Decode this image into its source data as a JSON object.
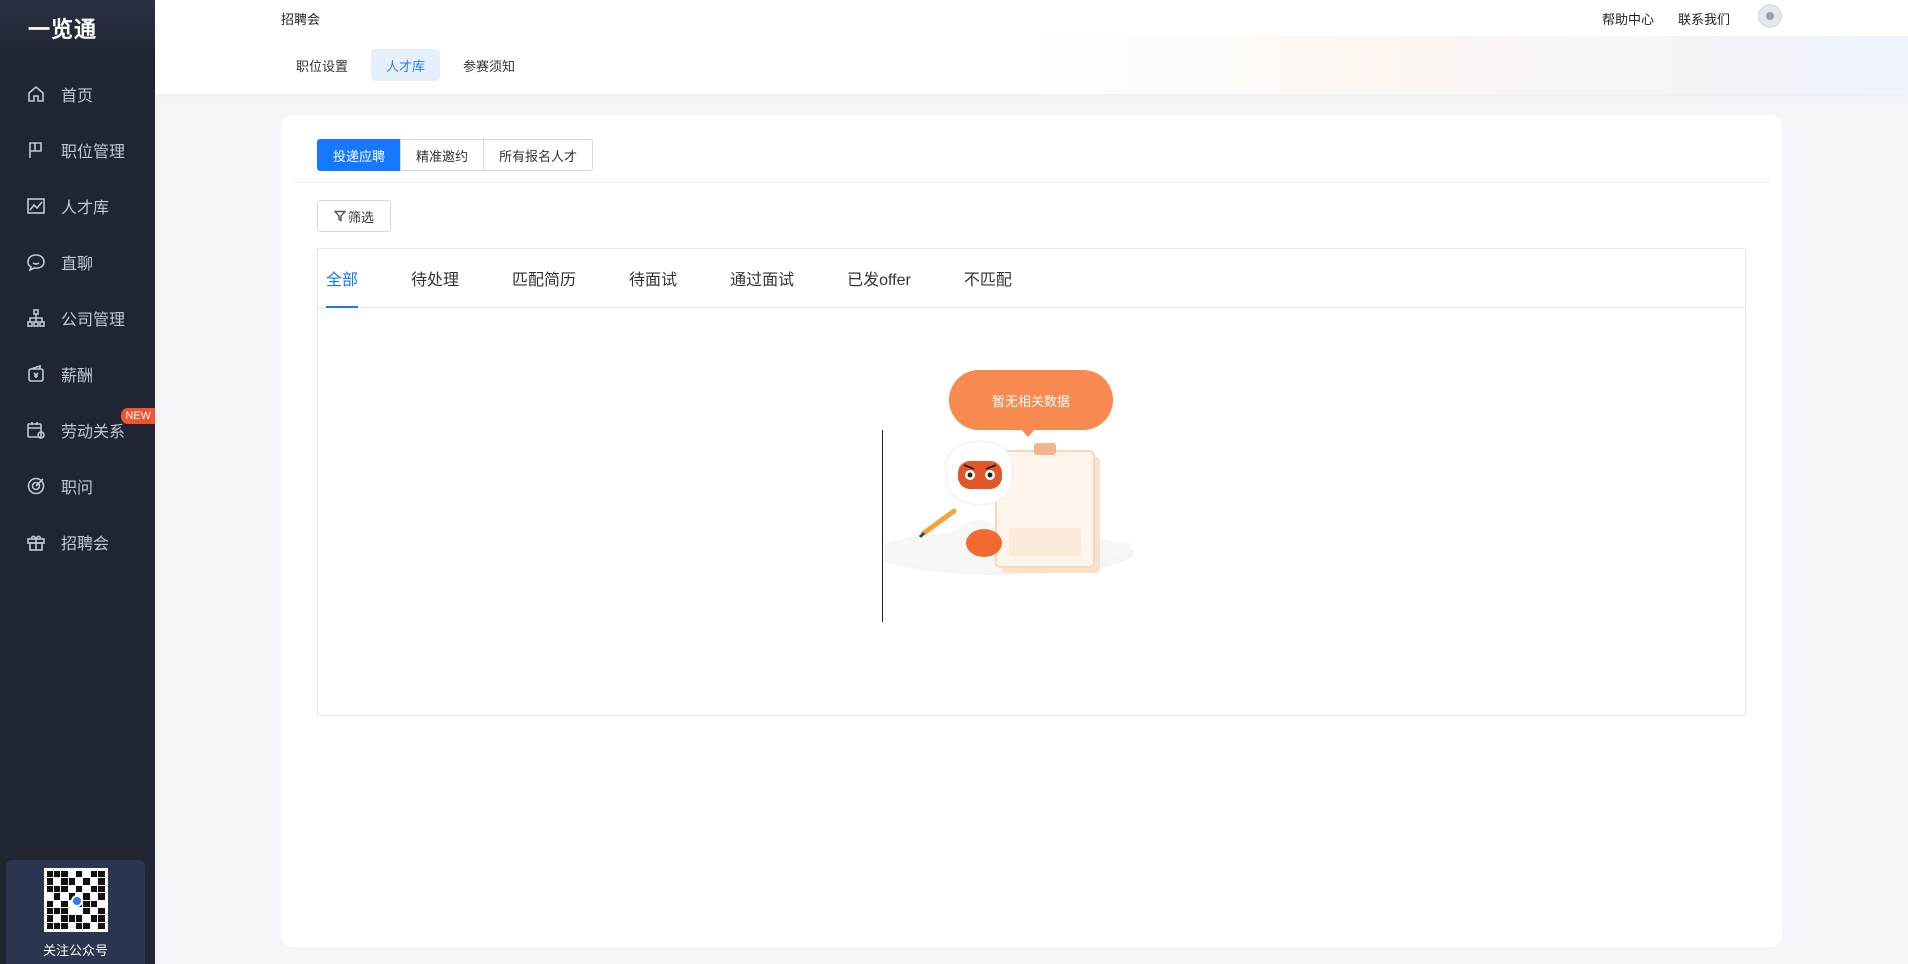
{
  "sidebar": {
    "logo": "一览通",
    "items": [
      {
        "label": "首页",
        "icon": "home-icon"
      },
      {
        "label": "职位管理",
        "icon": "flag-icon"
      },
      {
        "label": "人才库",
        "icon": "chart-line-icon"
      },
      {
        "label": "直聊",
        "icon": "chat-icon"
      },
      {
        "label": "公司管理",
        "icon": "org-icon"
      },
      {
        "label": "薪酬",
        "icon": "wallet-icon"
      },
      {
        "label": "劳动关系",
        "icon": "calendar-settings-icon",
        "badge": "NEW"
      },
      {
        "label": "职问",
        "icon": "target-icon"
      },
      {
        "label": "招聘会",
        "icon": "gift-icon"
      }
    ],
    "qr_label": "关注公众号"
  },
  "topbar": {
    "breadcrumb": "招聘会",
    "help": "帮助中心",
    "contact": "联系我们"
  },
  "subnav": {
    "tabs": [
      "职位设置",
      "人才库",
      "参赛须知"
    ],
    "active": "人才库"
  },
  "segments": {
    "items": [
      "投递应聘",
      "精准邀约",
      "所有报名人才"
    ],
    "active": "投递应聘"
  },
  "filter": {
    "label": "筛选"
  },
  "status_tabs": {
    "items": [
      "全部",
      "待处理",
      "匹配简历",
      "待面试",
      "通过面试",
      "已发offer",
      "不匹配"
    ],
    "active": "全部"
  },
  "empty_state": {
    "message": "暂无相关数据"
  },
  "colors": {
    "primary": "#1677ff",
    "sidebar_bg": "#1f2532",
    "accent_orange": "#f8894f",
    "badge_red": "#f2542d"
  }
}
